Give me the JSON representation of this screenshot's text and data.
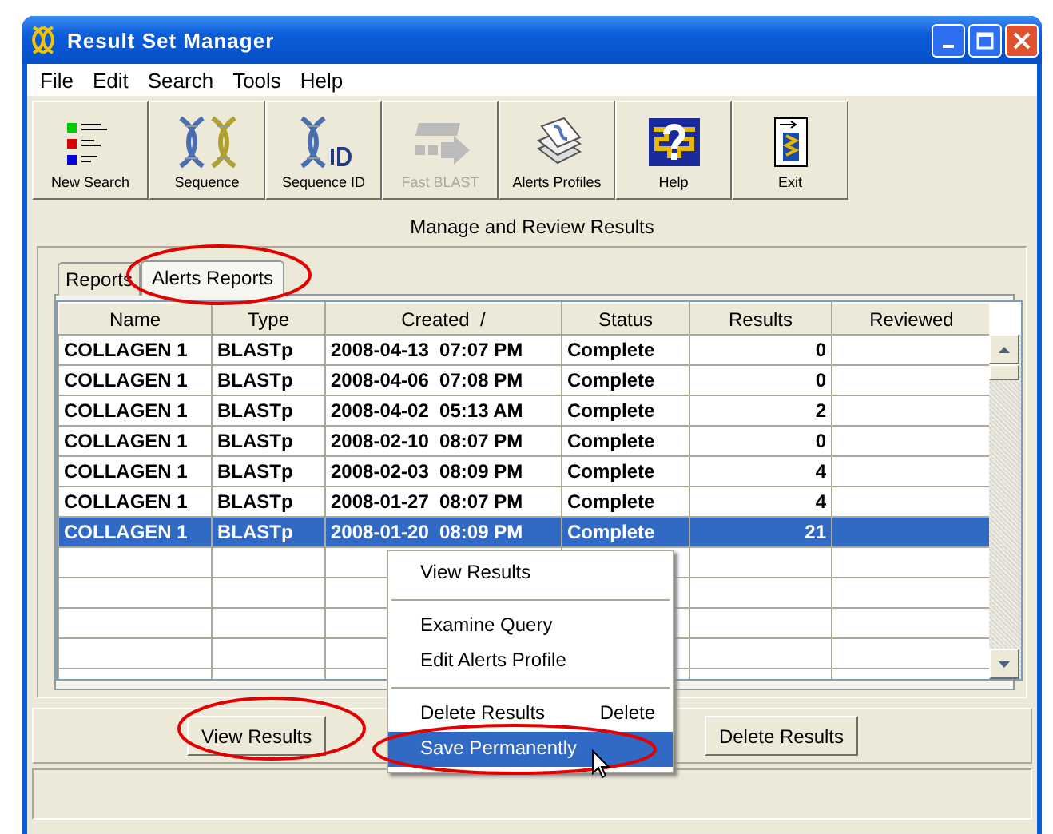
{
  "window": {
    "title": "Result Set Manager"
  },
  "menu_bar": [
    {
      "label": "File"
    },
    {
      "label": "Edit"
    },
    {
      "label": "Search"
    },
    {
      "label": "Tools"
    },
    {
      "label": "Help"
    }
  ],
  "toolbar": [
    {
      "label": "New Search",
      "kind": "list",
      "disabled": false
    },
    {
      "label": "Sequence",
      "kind": "dna",
      "disabled": false
    },
    {
      "label": "Sequence ID",
      "kind": "dnaid",
      "disabled": false
    },
    {
      "label": "Fast BLAST",
      "kind": "blast",
      "disabled": true
    },
    {
      "label": "Alerts Profiles",
      "kind": "pages",
      "disabled": false
    },
    {
      "label": "Help",
      "kind": "help",
      "disabled": false
    },
    {
      "label": "Exit",
      "kind": "exit",
      "disabled": false
    }
  ],
  "heading": "Manage and Review Results",
  "tabs": [
    {
      "label": "Reports",
      "selected": false
    },
    {
      "label": "Alerts Reports",
      "selected": true
    }
  ],
  "table": {
    "columns": [
      "Name",
      "Type",
      "Created  /",
      "Status",
      "Results",
      "Reviewed"
    ],
    "rows": [
      {
        "cells": [
          "COLLAGEN 1",
          "BLASTp",
          "2008-04-13  07:07 PM",
          "Complete",
          "0",
          ""
        ],
        "selected": false
      },
      {
        "cells": [
          "COLLAGEN 1",
          "BLASTp",
          "2008-04-06  07:08 PM",
          "Complete",
          "0",
          ""
        ],
        "selected": false
      },
      {
        "cells": [
          "COLLAGEN 1",
          "BLASTp",
          "2008-04-02  05:13 AM",
          "Complete",
          "2",
          ""
        ],
        "selected": false
      },
      {
        "cells": [
          "COLLAGEN 1",
          "BLASTp",
          "2008-02-10  08:07 PM",
          "Complete",
          "0",
          ""
        ],
        "selected": false
      },
      {
        "cells": [
          "COLLAGEN 1",
          "BLASTp",
          "2008-02-03  08:09 PM",
          "Complete",
          "4",
          ""
        ],
        "selected": false
      },
      {
        "cells": [
          "COLLAGEN 1",
          "BLASTp",
          "2008-01-27  08:07 PM",
          "Complete",
          "4",
          ""
        ],
        "selected": false
      },
      {
        "cells": [
          "COLLAGEN 1",
          "BLASTp",
          "2008-01-20  08:09 PM",
          "Complete",
          "21",
          ""
        ],
        "selected": true
      }
    ]
  },
  "context_menu": [
    {
      "kind": "item",
      "label": "View Results",
      "selected": false
    },
    {
      "kind": "separator"
    },
    {
      "kind": "item",
      "label": "Examine Query",
      "selected": false
    },
    {
      "kind": "item",
      "label": "Edit Alerts Profile",
      "selected": false
    },
    {
      "kind": "separator"
    },
    {
      "kind": "item",
      "label": "Delete Results",
      "shortcut": "Delete",
      "selected": false
    },
    {
      "kind": "item",
      "label": "Save Permanently",
      "selected": true
    }
  ],
  "buttons": [
    "View Results",
    "Delete Results"
  ]
}
